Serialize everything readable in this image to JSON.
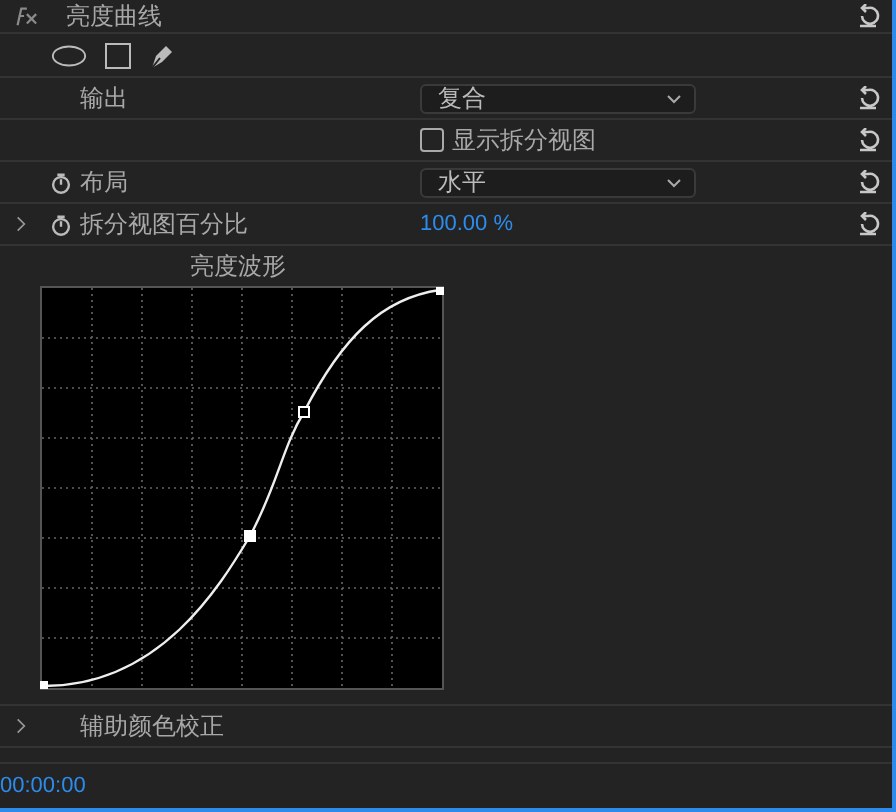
{
  "effect": {
    "title": "亮度曲线"
  },
  "rows": [
    {
      "kind": "dropdown",
      "label": "输出",
      "value": "复合"
    },
    {
      "kind": "checkbox",
      "label": "显示拆分视图",
      "checked": false
    },
    {
      "kind": "dropdown",
      "label": "布局",
      "value": "水平",
      "stopwatch": true
    },
    {
      "kind": "value",
      "label": "拆分视图百分比",
      "value": "100.00 %",
      "stopwatch": true,
      "expanded": false
    }
  ],
  "curve": {
    "title": "亮度波形"
  },
  "sections": [
    {
      "label": "辅助颜色校正",
      "expanded": false
    }
  ],
  "timecode": "00:00:00"
}
